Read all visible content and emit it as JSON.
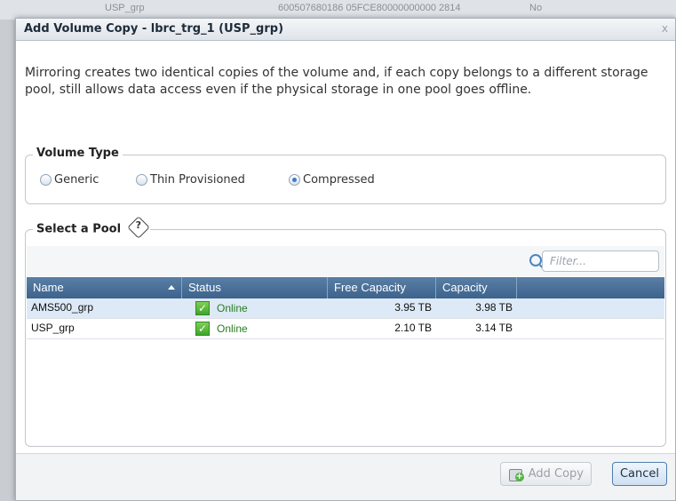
{
  "background_row": {
    "name": "USP_grp",
    "uid": "600507680186 05FCE80000000000 2814",
    "flag": "No"
  },
  "dialog": {
    "title": "Add Volume Copy - lbrc_trg_1 (USP_grp)",
    "close_label": "x",
    "intro": "Mirroring creates two identical copies of the volume and, if each copy belongs to a different storage pool, still allows data access even if the physical storage in one pool goes offline."
  },
  "volume_type": {
    "legend": "Volume Type",
    "options": [
      {
        "label": "Generic",
        "selected": false
      },
      {
        "label": "Thin Provisioned",
        "selected": false
      },
      {
        "label": "Compressed",
        "selected": true
      }
    ]
  },
  "pool": {
    "legend": "Select a Pool",
    "help_icon": "help-icon",
    "filter_placeholder": "Filter...",
    "columns": [
      "Name",
      "Status",
      "Free Capacity",
      "Capacity"
    ],
    "rows": [
      {
        "name": "AMS500_grp",
        "status": "Online",
        "free": "3.95 TB",
        "capacity": "3.98 TB"
      },
      {
        "name": "USP_grp",
        "status": "Online",
        "free": "2.10 TB",
        "capacity": "3.14 TB"
      }
    ]
  },
  "footer": {
    "add_copy": "Add Copy",
    "cancel": "Cancel"
  },
  "colors": {
    "header": "#3c638d",
    "online": "#267d1e",
    "selected_row": "#dde9f6"
  }
}
